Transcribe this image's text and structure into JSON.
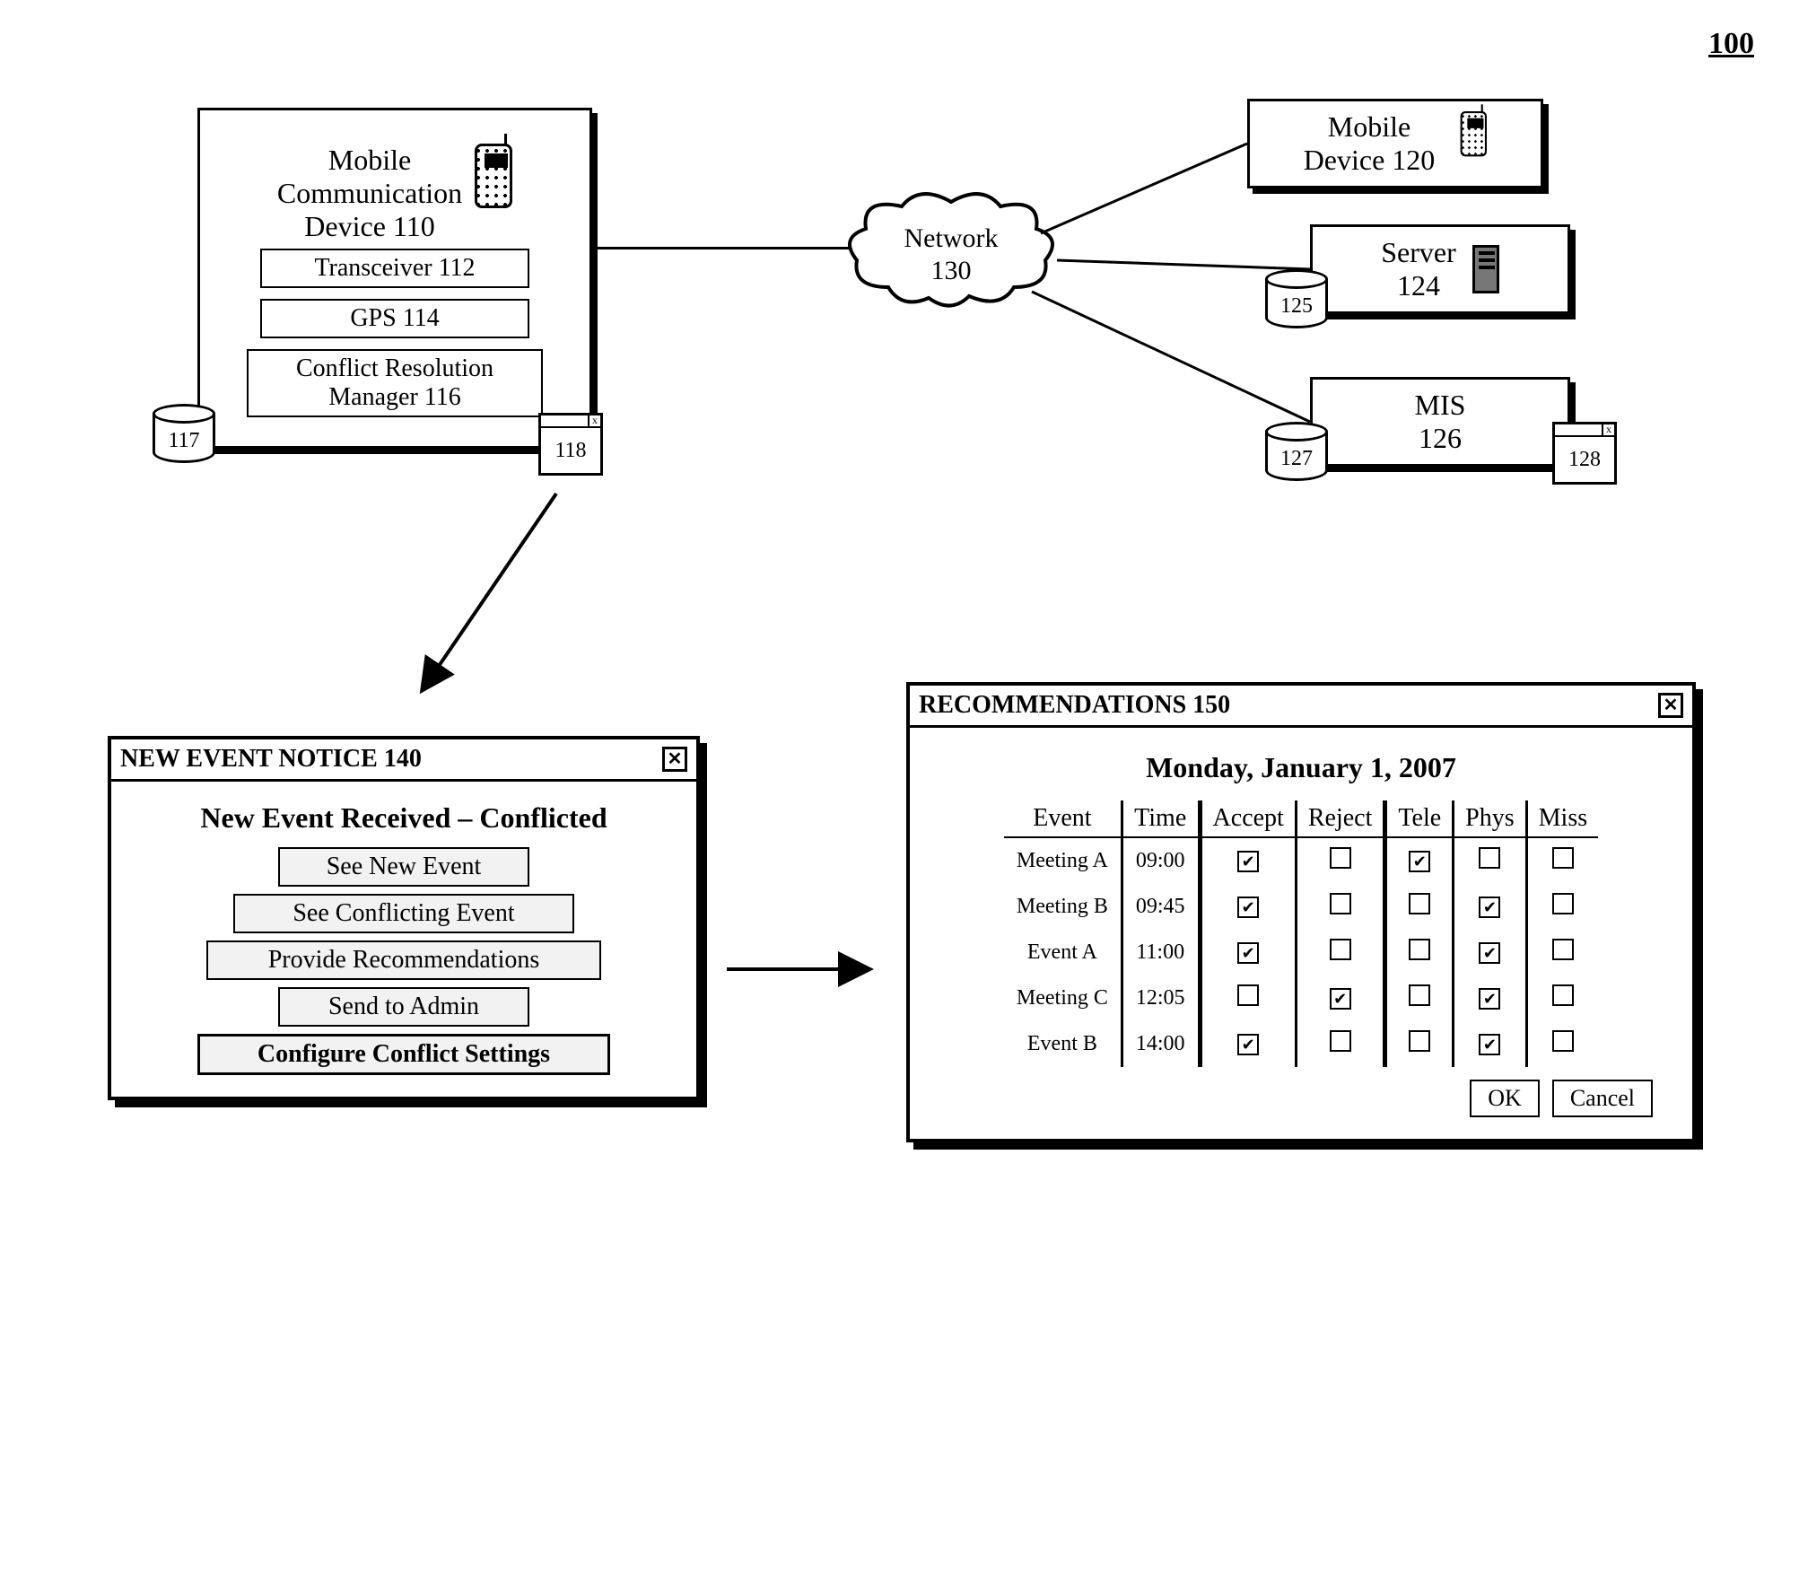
{
  "figure_number": "100",
  "device110": {
    "title_line1": "Mobile",
    "title_line2": "Communication",
    "title_line3": "Device 110",
    "sub_transceiver": "Transceiver 112",
    "sub_gps": "GPS 114",
    "sub_crm_line1": "Conflict Resolution",
    "sub_crm_line2": "Manager 116"
  },
  "db117": "117",
  "win118": "118",
  "network": {
    "line1": "Network",
    "line2": "130"
  },
  "device120": {
    "line1": "Mobile",
    "line2": "Device 120"
  },
  "server124": {
    "line1": "Server",
    "line2": "124"
  },
  "db125": "125",
  "mis126": {
    "line1": "MIS",
    "line2": "126"
  },
  "db127": "127",
  "win128": "128",
  "dialog140": {
    "title": "NEW EVENT NOTICE 140",
    "header": "New Event Received – Conflicted",
    "btn_see_new": "See New Event",
    "btn_see_conf": "See Conflicting Event",
    "btn_provide": "Provide Recommendations",
    "btn_send": "Send to Admin",
    "btn_configure": "Configure Conflict Settings"
  },
  "dialog150": {
    "title": "RECOMMENDATIONS 150",
    "date": "Monday, January 1, 2007",
    "th_event": "Event",
    "th_time": "Time",
    "th_accept": "Accept",
    "th_reject": "Reject",
    "th_tele": "Tele",
    "th_phys": "Phys",
    "th_miss": "Miss",
    "rows": [
      {
        "event": "Meeting A",
        "time": "09:00",
        "accept": true,
        "reject": false,
        "tele": true,
        "phys": false,
        "miss": false
      },
      {
        "event": "Meeting B",
        "time": "09:45",
        "accept": true,
        "reject": false,
        "tele": false,
        "phys": true,
        "miss": false
      },
      {
        "event": "Event A",
        "time": "11:00",
        "accept": true,
        "reject": false,
        "tele": false,
        "phys": true,
        "miss": false
      },
      {
        "event": "Meeting C",
        "time": "12:05",
        "accept": false,
        "reject": true,
        "tele": false,
        "phys": true,
        "miss": false
      },
      {
        "event": "Event B",
        "time": "14:00",
        "accept": true,
        "reject": false,
        "tele": false,
        "phys": true,
        "miss": false
      }
    ],
    "btn_ok": "OK",
    "btn_cancel": "Cancel"
  }
}
